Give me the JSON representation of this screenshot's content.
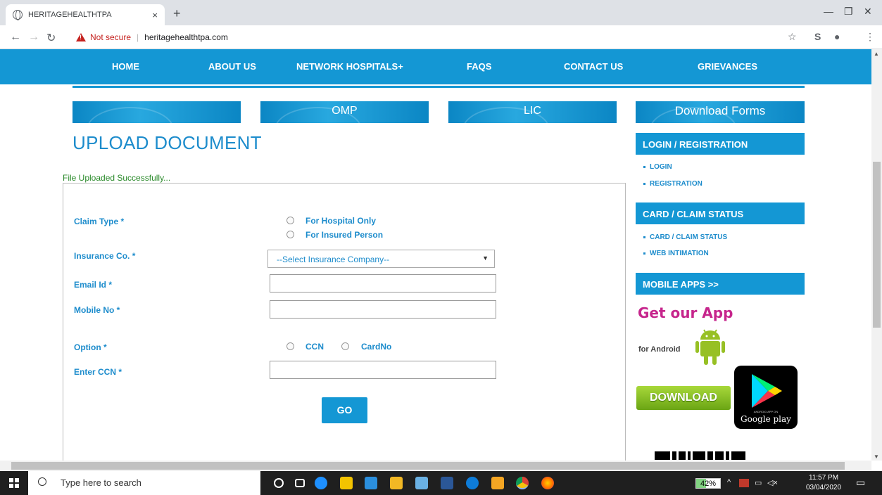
{
  "browser": {
    "tab_title": "HERITAGEHEALTHTPA",
    "tab_close": "×",
    "new_tab": "+",
    "not_secure": "Not secure",
    "url": "heritagehealthtpa.com"
  },
  "nav": {
    "items": [
      "HOME",
      "ABOUT US",
      "NETWORK HOSPITALS+",
      "FAQS",
      "CONTACT US",
      "GRIEVANCES"
    ]
  },
  "banners": [
    "",
    "OMP",
    "LIC",
    "Download Forms"
  ],
  "page_title": "UPLOAD DOCUMENT",
  "success_message": "File Uploaded Successfully...",
  "form": {
    "claim_type_label": "Claim Type *",
    "claim_options": [
      "For Hospital Only",
      "For Insured Person"
    ],
    "insurance_label": "Insurance Co. *",
    "insurance_selected": "--Select Insurance Company--",
    "email_label": "Email Id *",
    "mobile_label": "Mobile No *",
    "option_label": "Option *",
    "option_choices": [
      "CCN",
      "CardNo"
    ],
    "enter_ccn_label": "Enter CCN *",
    "go_label": "GO"
  },
  "sidebar": {
    "login_heading": "LOGIN / REGISTRATION",
    "login_links": [
      "LOGIN",
      "REGISTRATION"
    ],
    "status_heading": "CARD / CLAIM STATUS",
    "status_links": [
      "CARD / CLAIM STATUS",
      "WEB INTIMATION"
    ],
    "mobile_heading": "MOBILE APPS >>",
    "get_app": "Get our App",
    "for_android": "for Android",
    "download": "DOWNLOAD",
    "google_play_small": "ANDROID APP ON",
    "google_play": "Google play"
  },
  "taskbar": {
    "search_placeholder": "Type here to search",
    "battery": "42%",
    "time": "11:57 PM",
    "date": "03/04/2020"
  },
  "colors": {
    "brand_blue": "#1497d4",
    "success_green": "#2a8a2a",
    "app_pink": "#c6258c"
  }
}
